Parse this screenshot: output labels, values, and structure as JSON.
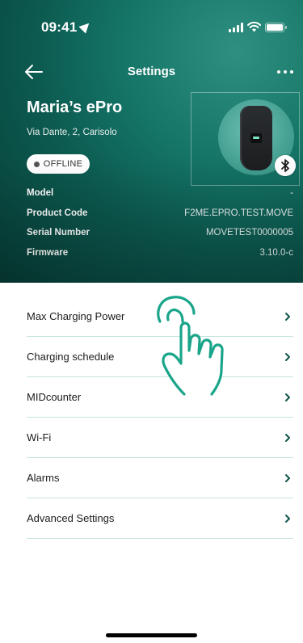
{
  "status_bar": {
    "time": "09:41"
  },
  "nav": {
    "title": "Settings",
    "back_icon": "arrow-left-icon",
    "more_icon": "more-dots-icon"
  },
  "device": {
    "name": "Maria’s ePro",
    "address": "Via Dante, 2, Carisolo",
    "status": "OFFLINE",
    "status_color": "#555555",
    "connectivity_icon": "bluetooth-icon"
  },
  "info": [
    {
      "label": "Model",
      "value": "-"
    },
    {
      "label": "Product Code",
      "value": "F2ME.EPRO.TEST.MOVE"
    },
    {
      "label": "Serial Number",
      "value": "MOVETEST0000005"
    },
    {
      "label": "Firmware",
      "value": "3.10.0-c"
    }
  ],
  "menu": [
    {
      "label": "Max Charging Power"
    },
    {
      "label": "Charging schedule"
    },
    {
      "label": "MIDcounter"
    },
    {
      "label": "Wi-Fi"
    },
    {
      "label": "Alarms"
    },
    {
      "label": "Advanced Settings"
    }
  ],
  "colors": {
    "header_primary": "#0c5a50",
    "accent": "#1aa58a",
    "divider": "#c5e4de"
  }
}
